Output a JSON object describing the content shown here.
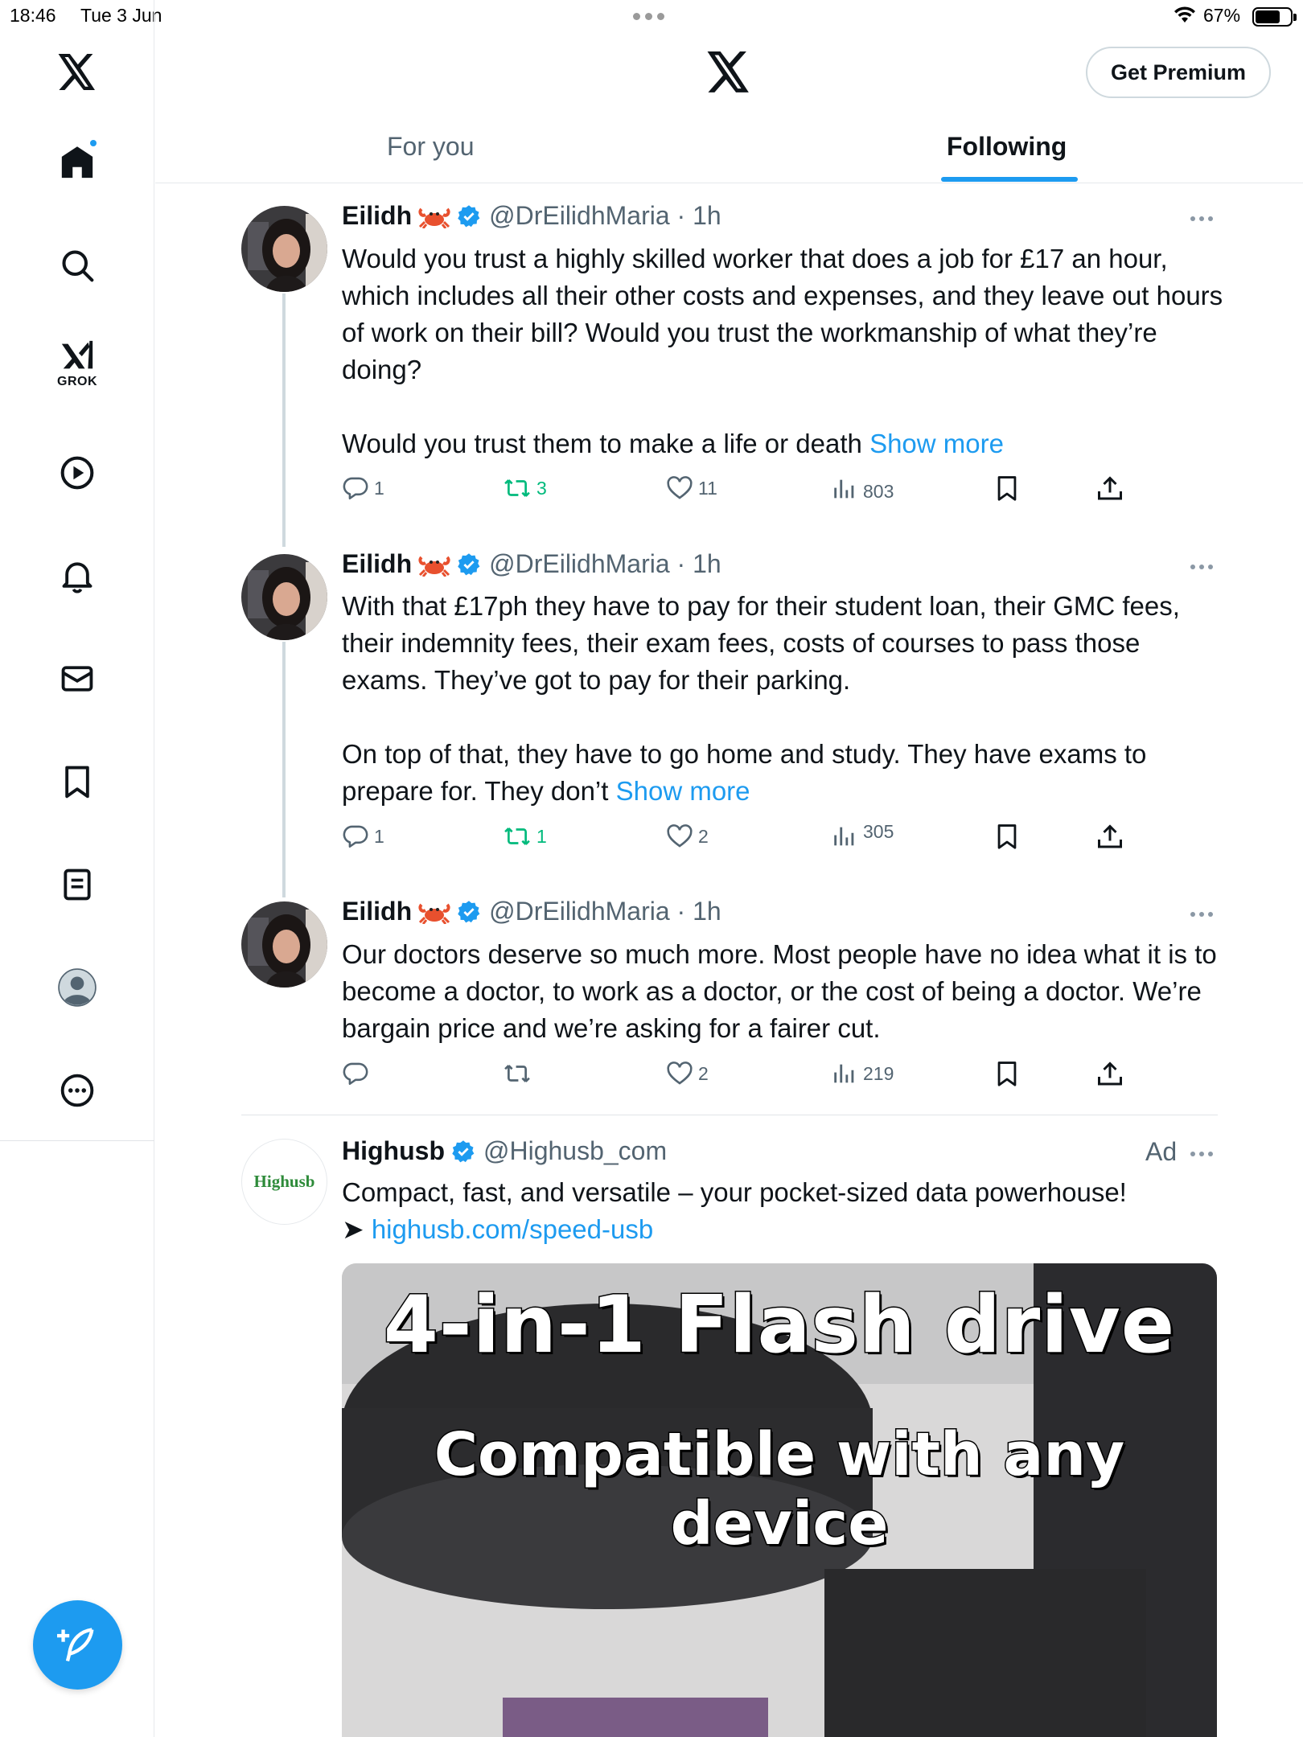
{
  "status_bar": {
    "time": "18:46",
    "date": "Tue 3 Jun",
    "battery": "67%"
  },
  "header": {
    "premium_label": "Get Premium"
  },
  "tabs": [
    {
      "label": "For you"
    },
    {
      "label": "Following"
    }
  ],
  "sidebar": {
    "grok_label": "GROK"
  },
  "tweets": [
    {
      "name": "Eilidh",
      "handle_time": "@DrEilidhMaria · 1h",
      "text_1": "Would you trust a highly skilled worker that does a job for £17 an hour, which includes all their other costs and expenses, and they leave out hours of work on their bill? Would you trust the workmanship of what they’re doing?",
      "text_2": "Would you trust them to make a life or death",
      "show_more": "Show more",
      "replies": "1",
      "retweets": "3",
      "likes": "11",
      "views": "803"
    },
    {
      "name": "Eilidh",
      "handle_time": "@DrEilidhMaria · 1h",
      "text_1": "With that £17ph they have to pay for their student loan, their GMC fees, their indemnity fees, their exam fees, costs of courses to pass those exams. They’ve got to pay for their parking.",
      "text_2": "On top of that, they have to go home and study. They have exams to prepare for. They don’t",
      "show_more": "Show more",
      "replies": "1",
      "retweets": "1",
      "likes": "2",
      "views": "305"
    },
    {
      "name": "Eilidh",
      "handle_time": "@DrEilidhMaria · 1h",
      "text_1": "Our doctors deserve so much more. Most people have no idea what it is to become a doctor, to work as a doctor, or the cost of being a doctor. We’re bargain price and we’re asking for a fairer cut.",
      "replies": "",
      "retweets": "",
      "likes": "2",
      "views": "219"
    }
  ],
  "ad": {
    "name": "Highusb",
    "handle": "@Highusb_com",
    "ad_label": "Ad",
    "avatar_text": "Highusb",
    "text": "Compact, fast, and versatile – your pocket-sized data powerhouse!",
    "arrow": "➤",
    "link": "highusb.com/speed-usb",
    "media_line_1": "4-in-1 Flash drive",
    "media_line_2": "Compatible with any device"
  },
  "colors": {
    "accent": "#1d9bf0",
    "retweet": "#00ba7c",
    "muted": "#536471"
  }
}
